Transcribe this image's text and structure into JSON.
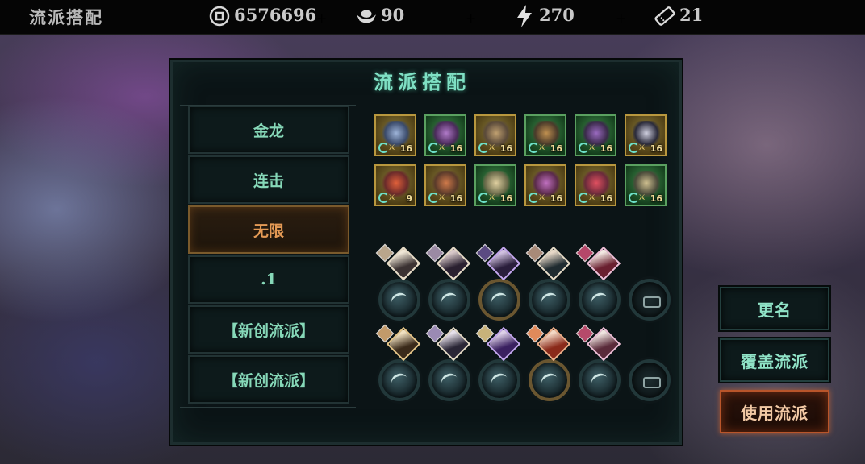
{
  "topbar": {
    "title": "流派搭配",
    "resources": [
      {
        "icon": "coin-icon",
        "value": "6576696"
      },
      {
        "icon": "ingot-icon",
        "value": "90"
      },
      {
        "icon": "lightning-icon",
        "value": "270"
      },
      {
        "icon": "ticket-icon",
        "value": "21"
      }
    ],
    "plus": "+"
  },
  "panel": {
    "title": "流派搭配",
    "loadouts": [
      {
        "label": "金龙",
        "active": false
      },
      {
        "label": "连击",
        "active": false
      },
      {
        "label": "无限",
        "active": true
      },
      {
        "label": ".1",
        "active": false
      },
      {
        "label": "【新创流派】",
        "active": false
      },
      {
        "label": "【新创流派】",
        "active": false
      }
    ],
    "equipment": [
      {
        "level": "16",
        "rarity": "gold"
      },
      {
        "level": "16",
        "rarity": "green"
      },
      {
        "level": "16",
        "rarity": "gold"
      },
      {
        "level": "16",
        "rarity": "green"
      },
      {
        "level": "16",
        "rarity": "green"
      },
      {
        "level": "16",
        "rarity": "gold"
      },
      {
        "level": "9",
        "rarity": "gold"
      },
      {
        "level": "16",
        "rarity": "gold"
      },
      {
        "level": "16",
        "rarity": "green"
      },
      {
        "level": "16",
        "rarity": "gold"
      },
      {
        "level": "16",
        "rarity": "gold"
      },
      {
        "level": "16",
        "rarity": "green"
      }
    ]
  },
  "buttons": {
    "rename": "更名",
    "overwrite": "覆盖流派",
    "use": "使用流派"
  },
  "colors": {
    "accent_green": "#86d8b8",
    "active_orange": "#e49a55",
    "primary_button_border": "#b9552a",
    "gold_frame": "#8a7233"
  }
}
